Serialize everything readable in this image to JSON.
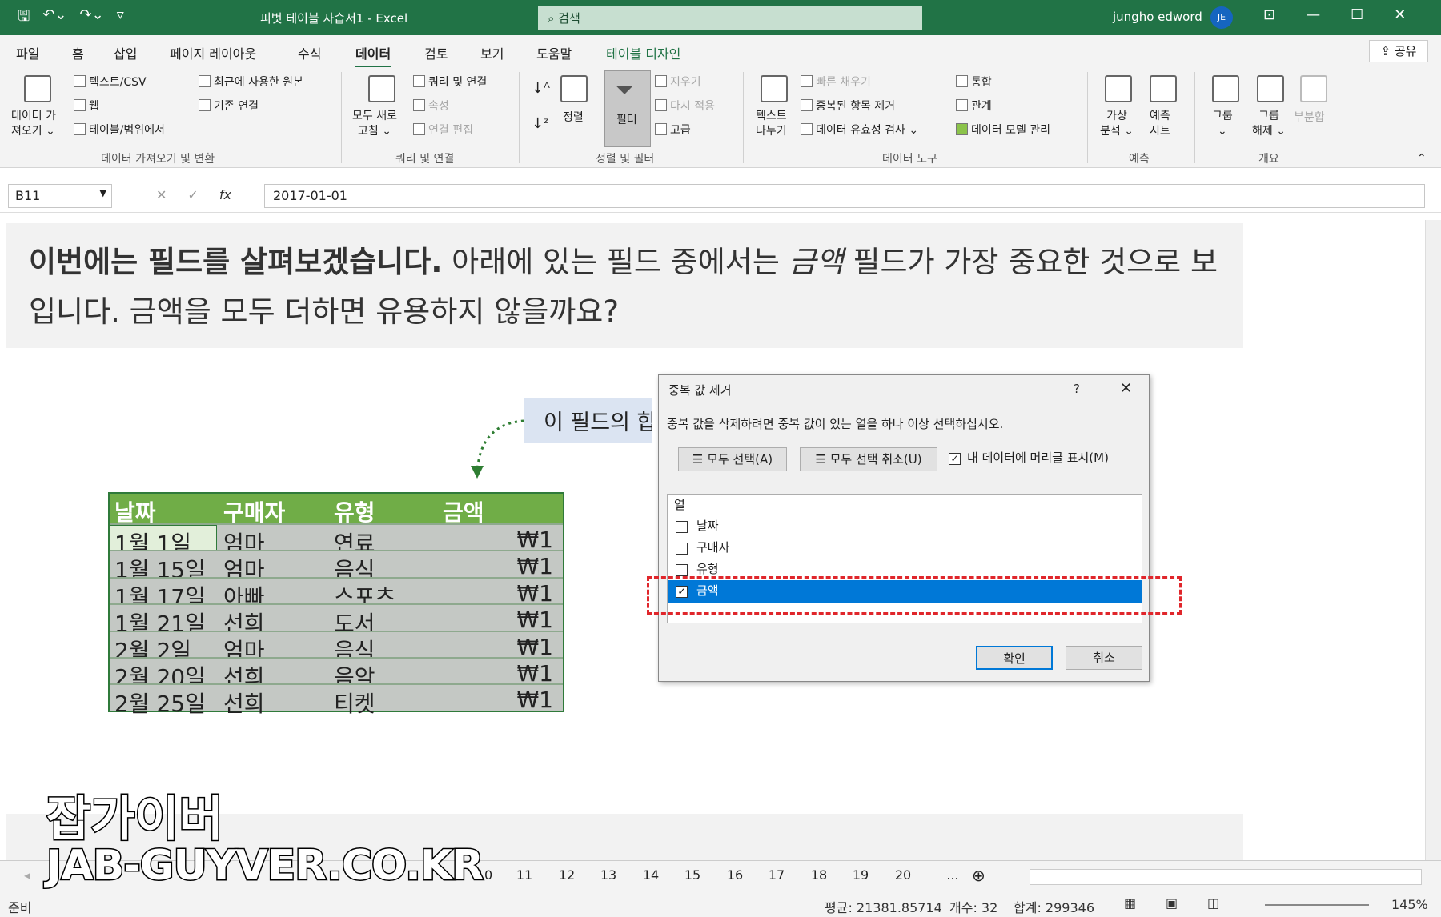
{
  "titlebar": {
    "title": "피벗 테이블 자습서1 - Excel",
    "search": "검색",
    "user": "jungho edword",
    "initials": "JE"
  },
  "tabs": [
    "파일",
    "홈",
    "삽입",
    "페이지 레이아웃",
    "수식",
    "데이터",
    "검토",
    "보기",
    "도움말",
    "테이블 디자인"
  ],
  "share": "공유",
  "ribbon": {
    "get_data": "데이터 가\n져오기 ⌄",
    "text_csv": "텍스트/CSV",
    "web": "웹",
    "from_table": "테이블/범위에서",
    "recent": "최근에 사용한 원본",
    "existing": "기존 연결",
    "refresh": "모두 새로\n고침 ⌄",
    "queries": "쿼리 및 연결",
    "props": "속성",
    "edit_links": "연결 편집",
    "sort": "정렬",
    "filter": "필터",
    "clear": "지우기",
    "reapply": "다시 적용",
    "advanced": "고급",
    "text_to_cols": "텍스트\n나누기",
    "flash_fill": "빠른 채우기",
    "remove_dup": "중복된 항목 제거",
    "validation": "데이터 유효성 검사",
    "consolidate": "통합",
    "relations": "관계",
    "data_model": "데이터 모델 관리",
    "whatif": "가상\n분석 ⌄",
    "forecast": "예측\n시트",
    "group": "그룹\n⌄",
    "ungroup": "그룹\n해제 ⌄",
    "subtotal": "부분합",
    "groups": [
      "데이터 가져오기 및 변환",
      "쿼리 및 연결",
      "정렬 및 필터",
      "데이터 도구",
      "예측",
      "개요"
    ]
  },
  "formula": {
    "cell": "B11",
    "value": "2017-01-01"
  },
  "intro": {
    "bold": "이번에는 필드를 살펴보겠습니다.",
    "p1": " 아래에 있는 필드 중에서는 ",
    "italic": "금액",
    "p2": " 필드가 가장 중요한 것으로 보입니다. 금액을 모두 더하면 유용하지 않을까요?"
  },
  "callout": "이 필드의 합",
  "table": {
    "headers": [
      "날짜",
      "구매자",
      "유형",
      "금액"
    ],
    "rows": [
      [
        "1월 1일",
        "엄마",
        "연료",
        "₩1"
      ],
      [
        "1월 15일",
        "엄마",
        "음식",
        "₩1"
      ],
      [
        "1월 17일",
        "아빠",
        "스포츠",
        "₩1"
      ],
      [
        "1월 21일",
        "선희",
        "도서",
        "₩1"
      ],
      [
        "2월 2일",
        "엄마",
        "음식",
        "₩1"
      ],
      [
        "2월 20일",
        "선희",
        "음악",
        "₩1"
      ],
      [
        "2월 25일",
        "선희",
        "티켓",
        "₩1"
      ]
    ]
  },
  "dialog": {
    "title": "중복 값 제거",
    "help": "?",
    "close": "✕",
    "instruction": "중복 값을 삭제하려면 중복 값이 있는 열을 하나 이상 선택하십시오.",
    "select_all": "모두 선택(A)",
    "unselect_all": "모두 선택 취소(U)",
    "header_cb": "내 데이터에 머리글 표시(M)",
    "col_header": "열",
    "columns": [
      "날짜",
      "구매자",
      "유형",
      "금액"
    ],
    "ok": "확인",
    "cancel": "취소"
  },
  "sheet_tabs": [
    "10",
    "11",
    "12",
    "13",
    "14",
    "15",
    "16",
    "17",
    "18",
    "19",
    "20",
    "..."
  ],
  "status": {
    "ready": "준비",
    "avg": "평균: 21381.85714",
    "count": "개수: 32",
    "sum": "합계: 299346",
    "zoom": "145%"
  },
  "watermark": {
    "line1": "잡가이버",
    "line2": "JAB-GUYVER.CO.KR"
  }
}
